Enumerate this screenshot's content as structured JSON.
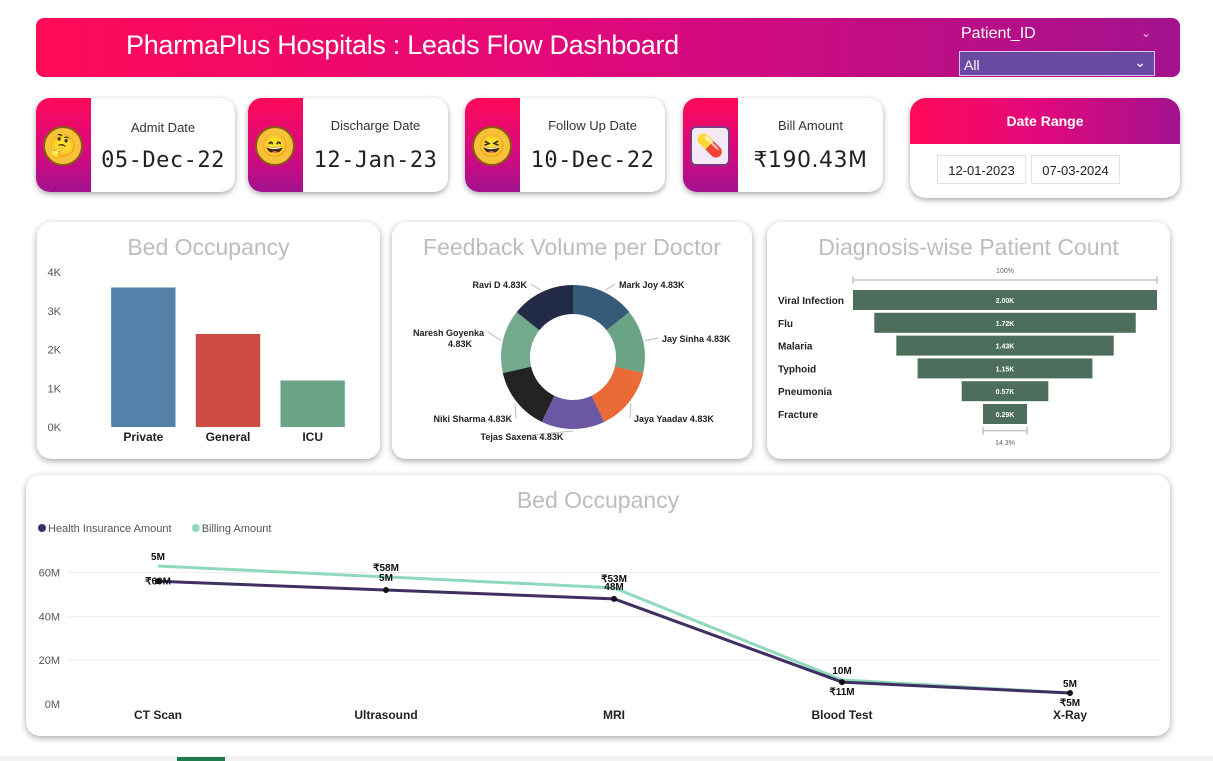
{
  "header": {
    "title": "PharmaPlus Hospitals : Leads Flow Dashboard",
    "slicer_label": "Patient_ID",
    "slicer_value": "All"
  },
  "kpis": [
    {
      "label": "Admit Date",
      "value": "05-Dec-22",
      "icon": "thinking-face-icon",
      "glyph": "🤔"
    },
    {
      "label": "Discharge Date",
      "value": "12-Jan-23",
      "icon": "smiling-face-icon",
      "glyph": "😄"
    },
    {
      "label": "Follow Up Date",
      "value": "10-Dec-22",
      "icon": "laughing-face-icon",
      "glyph": "😆"
    },
    {
      "label": "Bill Amount",
      "value": "₹190.43M",
      "icon": "medical-bill-icon",
      "glyph": "💊"
    }
  ],
  "date_range": {
    "title": "Date Range",
    "start": "12-01-2023",
    "end": "07-03-2024"
  },
  "chart_data": [
    {
      "type": "bar",
      "title": "Bed Occupancy",
      "categories": [
        "Private",
        "General",
        "ICU"
      ],
      "values": [
        3600,
        2400,
        1200
      ],
      "colors": [
        "#5580a9",
        "#cd4b45",
        "#6aa386"
      ],
      "yticks": [
        "0K",
        "1K",
        "2K",
        "3K",
        "4K"
      ],
      "ylim": [
        0,
        4000
      ]
    },
    {
      "type": "pie",
      "title": "Feedback Volume per Doctor",
      "slices": [
        {
          "name": "Mark Joy",
          "label": "Mark Joy 4.83K",
          "value": 4.83,
          "color": "#365a78"
        },
        {
          "name": "Jay Sinha",
          "label": "Jay Sinha 4.83K",
          "value": 4.83,
          "color": "#6aa386"
        },
        {
          "name": "Jaya Yaadav",
          "label": "Jaya Yaadav 4.83K",
          "value": 4.83,
          "color": "#e86b38"
        },
        {
          "name": "Tejas Saxena",
          "label": "Tejas Saxena 4.83K",
          "value": 4.83,
          "color": "#6a58a4"
        },
        {
          "name": "Niki Sharma",
          "label": "Niki Sharma 4.83K",
          "value": 4.83,
          "color": "#232323"
        },
        {
          "name": "Naresh Goyenka",
          "label": "Naresh Goyenka",
          "label2": "4.83K",
          "value": 4.83,
          "color": "#73a98d"
        },
        {
          "name": "Ravi D",
          "label": "Ravi D 4.83K",
          "value": 4.83,
          "color": "#222b45"
        }
      ]
    },
    {
      "type": "bar",
      "subtype": "funnel",
      "title": "Diagnosis-wise Patient Count",
      "top_label": "100%",
      "bottom_label": "14.3%",
      "color": "#4d6e5c",
      "categories": [
        "Viral Infection",
        "Flu",
        "Malaria",
        "Typhoid",
        "Pneumonia",
        "Fracture"
      ],
      "values": [
        2000,
        1720,
        1430,
        1150,
        570,
        290
      ],
      "labels": [
        "2.00K",
        "1.72K",
        "1.43K",
        "1.15K",
        "0.57K",
        "0.29K"
      ]
    },
    {
      "type": "line",
      "title": "Bed Occupancy",
      "categories": [
        "CT Scan",
        "Ultrasound",
        "MRI",
        "Blood Test",
        "X-Ray"
      ],
      "yticks": [
        "0M",
        "20M",
        "40M",
        "60M"
      ],
      "ylim": [
        0,
        68
      ],
      "series": [
        {
          "name": "Health Insurance Amount",
          "color": "#3f2f62",
          "values": [
            56,
            52,
            48,
            10,
            5
          ],
          "labels": [
            "₹60M",
            "5M",
            "48M",
            "₹11M",
            "₹5M"
          ]
        },
        {
          "name": "Billing Amount",
          "color": "#8fdabb",
          "values": [
            63,
            58,
            53,
            11,
            5
          ],
          "labels": [
            "5M",
            "₹58M",
            "₹53M",
            "10M",
            "5M"
          ]
        }
      ]
    }
  ]
}
